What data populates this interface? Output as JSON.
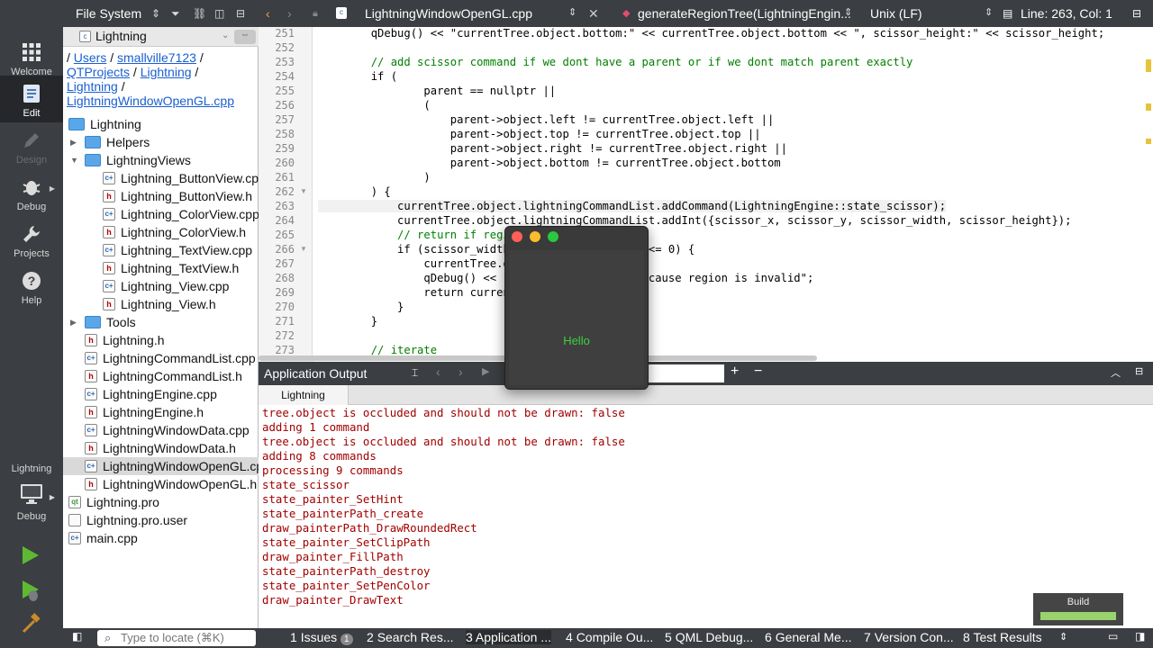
{
  "modebar": {
    "modes": [
      {
        "label": "Welcome",
        "icon": "grid-icon"
      },
      {
        "label": "Edit",
        "icon": "edit-icon"
      },
      {
        "label": "Design",
        "icon": "pen-icon"
      },
      {
        "label": "Debug",
        "icon": "bug-icon"
      },
      {
        "label": "Projects",
        "icon": "wrench-icon"
      },
      {
        "label": "Help",
        "icon": "help-icon"
      }
    ],
    "kit": {
      "project": "Lightning",
      "config": "Debug"
    }
  },
  "leftpanel": {
    "title": "File System",
    "project": "Lightning",
    "breadcrumb": {
      "prefix": "/ ",
      "links": [
        "Users",
        "smallville7123",
        "QTProjects",
        "Lightning",
        "Lightning",
        "LightningWindowOpenGL.cpp"
      ]
    },
    "tree": [
      {
        "label": "Lightning",
        "type": "folder"
      },
      {
        "label": "Helpers",
        "type": "folder"
      },
      {
        "label": "LightningViews",
        "type": "folder"
      },
      {
        "label": "Lightning_ButtonView.cpp",
        "type": "cpp"
      },
      {
        "label": "Lightning_ButtonView.h",
        "type": "h"
      },
      {
        "label": "Lightning_ColorView.cpp",
        "type": "cpp"
      },
      {
        "label": "Lightning_ColorView.h",
        "type": "h"
      },
      {
        "label": "Lightning_TextView.cpp",
        "type": "cpp"
      },
      {
        "label": "Lightning_TextView.h",
        "type": "h"
      },
      {
        "label": "Lightning_View.cpp",
        "type": "cpp"
      },
      {
        "label": "Lightning_View.h",
        "type": "h"
      },
      {
        "label": "Tools",
        "type": "folder"
      },
      {
        "label": "Lightning.h",
        "type": "h"
      },
      {
        "label": "LightningCommandList.cpp",
        "type": "cpp"
      },
      {
        "label": "LightningCommandList.h",
        "type": "h"
      },
      {
        "label": "LightningEngine.cpp",
        "type": "cpp"
      },
      {
        "label": "LightningEngine.h",
        "type": "h"
      },
      {
        "label": "LightningWindowData.cpp",
        "type": "cpp"
      },
      {
        "label": "LightningWindowData.h",
        "type": "h"
      },
      {
        "label": "LightningWindowOpenGL.cpp",
        "type": "cpp"
      },
      {
        "label": "LightningWindowOpenGL.h",
        "type": "h"
      },
      {
        "label": "Lightning.pro",
        "type": "pro"
      },
      {
        "label": "Lightning.pro.user",
        "type": "file"
      },
      {
        "label": "main.cpp",
        "type": "cpp"
      }
    ]
  },
  "editor": {
    "file": "LightningWindowOpenGL.cpp",
    "symbol": "generateRegionTree(LightningEngin...",
    "line_endings": "Unix (LF)",
    "position": "Line: 263, Col: 1",
    "lines": [
      {
        "n": "251",
        "text": "        qDebug() << \"currentTree.object.bottom:\" << currentTree.object.bottom << \", scissor_height:\" << scissor_height;"
      },
      {
        "n": "252",
        "text": ""
      },
      {
        "n": "253",
        "text": "        // add scissor command if we dont have a parent or if we dont match parent exactly"
      },
      {
        "n": "254",
        "text": "        if ("
      },
      {
        "n": "255",
        "text": "                parent == nullptr ||"
      },
      {
        "n": "256",
        "text": "                ("
      },
      {
        "n": "257",
        "text": "                    parent->object.left != currentTree.object.left ||"
      },
      {
        "n": "258",
        "text": "                    parent->object.top != currentTree.object.top ||"
      },
      {
        "n": "259",
        "text": "                    parent->object.right != currentTree.object.right ||"
      },
      {
        "n": "260",
        "text": "                    parent->object.bottom != currentTree.object.bottom"
      },
      {
        "n": "261",
        "text": "                )"
      },
      {
        "n": "262",
        "text": "        ) {"
      },
      {
        "n": "263",
        "text": "            currentTree.object.lightningCommandList.addCommand(LightningEngine::state_scissor);"
      },
      {
        "n": "264",
        "text": "            currentTree.object.lightningCommandList.addInt({scissor_x, scissor_y, scissor_width, scissor_height});"
      },
      {
        "n": "265",
        "text": "            // return if regi"
      },
      {
        "n": "266",
        "text": "            if (scissor_width                     <= 0) {"
      },
      {
        "n": "267",
        "text": "                currentTree.o                  ;"
      },
      {
        "n": "268",
        "text": "                qDebug() << \"                   because region is invalid\";"
      },
      {
        "n": "269",
        "text": "                return curren"
      },
      {
        "n": "270",
        "text": "            }"
      },
      {
        "n": "271",
        "text": "        }"
      },
      {
        "n": "272",
        "text": ""
      },
      {
        "n": "273",
        "text": "        // iterate"
      }
    ]
  },
  "output": {
    "title": "Application Output",
    "tab": "Lightning",
    "lines": [
      "tree.object is occluded and should not be drawn: false",
      "adding 1 command",
      "tree.object is occluded and should not be drawn: false",
      "adding 8 commands",
      "processing 9 commands",
      "state_scissor",
      "state_painter_SetHint",
      "state_painterPath_create",
      "draw_painterPath_DrawRoundedRect",
      "state_painter_SetClipPath",
      "draw_painter_FillPath",
      "state_painterPath_destroy",
      "state_painter_SetPenColor",
      "draw_painter_DrawText"
    ],
    "build_label": "Build"
  },
  "statusbar": {
    "locator_placeholder": "Type to locate (⌘K)",
    "tabs": [
      {
        "num": "1",
        "label": "Issues",
        "badge": "1"
      },
      {
        "num": "2",
        "label": "Search Res..."
      },
      {
        "num": "3",
        "label": "Application ..."
      },
      {
        "num": "4",
        "label": "Compile Ou..."
      },
      {
        "num": "5",
        "label": "QML Debug..."
      },
      {
        "num": "6",
        "label": "General Me..."
      },
      {
        "num": "7",
        "label": "Version Con..."
      },
      {
        "num": "8",
        "label": "Test Results"
      }
    ]
  },
  "hello_window": {
    "text": "Hello"
  },
  "colors": {
    "output_text": "#a00000",
    "hello_text": "#3bd23b",
    "build_progress": "#9ad36e"
  }
}
